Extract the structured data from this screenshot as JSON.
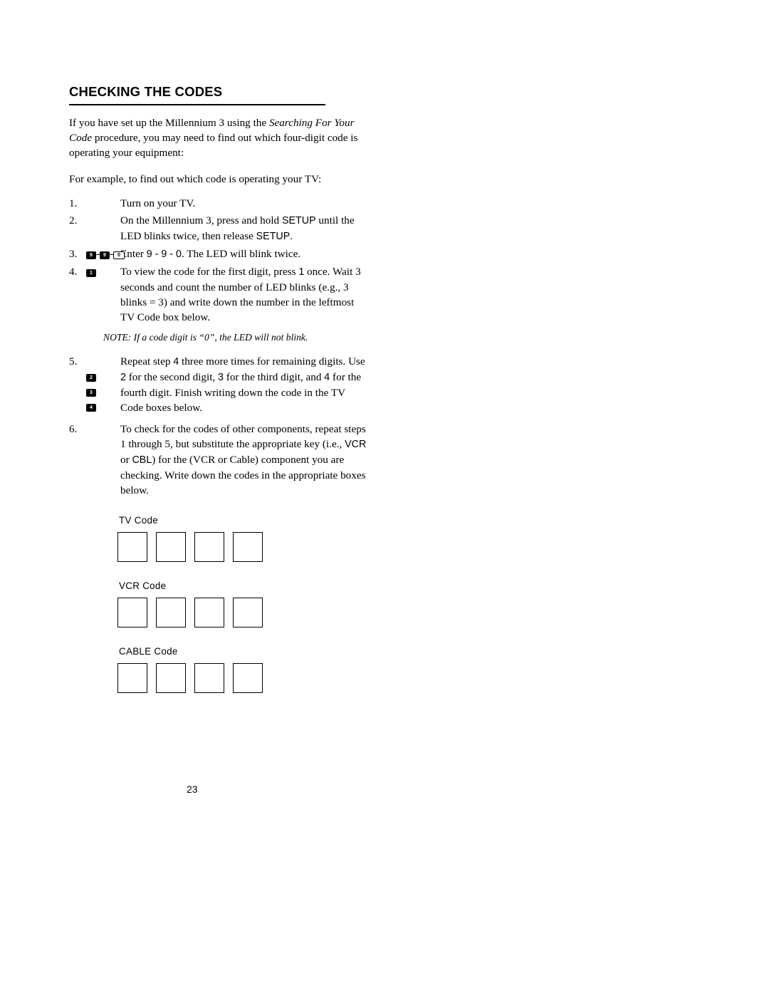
{
  "document": {
    "title": "Checking the Codes",
    "page_number": "23"
  },
  "intro": {
    "paragraph1_part1": "If you have set up the Millennium 3 using the ",
    "paragraph1_italic1": "Searching For Your Code",
    "paragraph1_part2": " procedure, you may need to find out which four-digit code is operating your equipment:",
    "paragraph2": "For example, to find out which code is operating your TV:"
  },
  "steps": [
    {
      "number": "1.",
      "icon": "",
      "text": "Turn on your TV."
    },
    {
      "number": "2.",
      "icon": "setup-key",
      "icon_label": "SETUP",
      "text_part1": "On the Millennium 3, press and hold ",
      "text_bold1": "SETUP",
      "text_part2": " until the LED blinks twice, then release ",
      "text_bold2": "SETUP",
      "text_part3": "."
    },
    {
      "number": "3.",
      "icon": "nine-nine-zero-keys",
      "keys": [
        "9",
        "9",
        "0"
      ],
      "text_part1": "Enter ",
      "text_bold1": "9 - 9 - 0",
      "text_part2": ". The LED will blink twice."
    },
    {
      "number": "4.",
      "icon": "one-key",
      "keys": [
        "1"
      ],
      "text_part1": "To view the code for the first digit, press ",
      "text_bold1": "1",
      "text_part2": " once. Wait 3 seconds and count the number of LED blinks (e.g., 3 blinks = 3) and write down the number in the leftmost TV Code box below."
    },
    {
      "number": "5.",
      "icon": "two-three-four-keys",
      "keys": [
        "2",
        "3",
        "4"
      ],
      "text_part1": "Repeat step ",
      "text_bold1": "4",
      "text_part2": " three more times for remaining digits. Use ",
      "text_bold2": "2",
      "text_part3": " for the second digit, ",
      "text_bold3": "3",
      "text_part4": " for the third digit, and ",
      "text_bold4": "4",
      "text_part5": " for the fourth digit. Finish writing down the code in the TV Code boxes below."
    },
    {
      "number": "6.",
      "icon": "",
      "text_part1": "To check for the codes of other components, repeat steps 1 through 5, but substitute the appropriate key (i.e., ",
      "text_bold1": "VCR",
      "text_part2": " or ",
      "text_bold2": "CBL",
      "text_part3": ") for the (VCR or Cable) component you are checking. Write down the codes in the appropriate boxes below."
    }
  ],
  "note": "NOTE: If a code digit is “0”, the LED will not blink.",
  "code_sections": [
    {
      "label": "TV Code",
      "boxes": [
        "",
        "",
        "",
        ""
      ]
    },
    {
      "label": "VCR Code",
      "boxes": [
        "",
        "",
        "",
        ""
      ]
    },
    {
      "label": "CABLE Code",
      "boxes": [
        "",
        "",
        "",
        ""
      ]
    }
  ]
}
